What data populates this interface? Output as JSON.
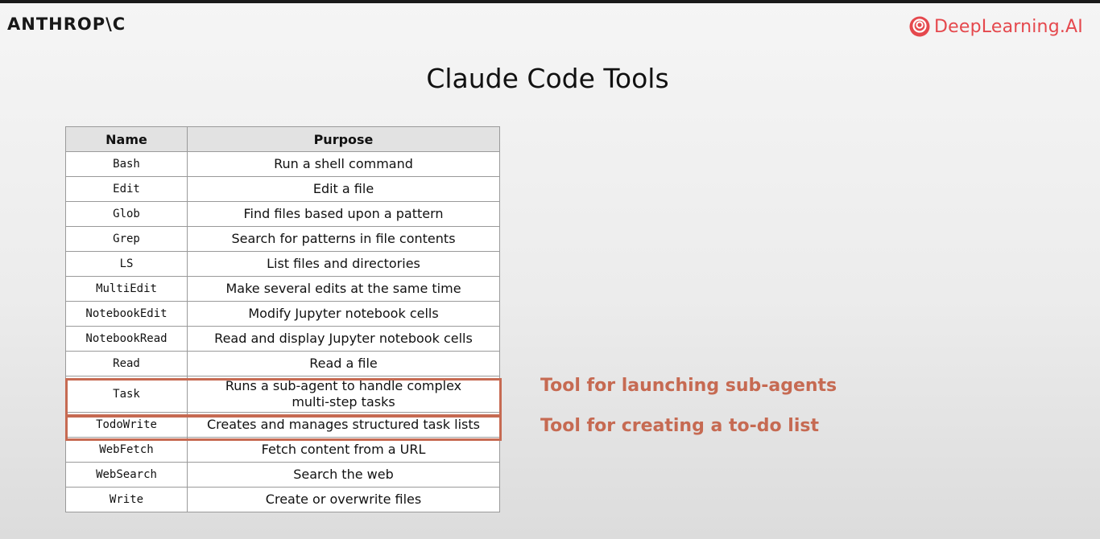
{
  "header": {
    "brand_left": "ANTHROP\\C",
    "brand_right": "DeepLearning.AI",
    "brand_right_icon": "deeplearning-ai-logo-icon",
    "brand_right_color": "#e5484d"
  },
  "slide": {
    "title": "Claude Code Tools"
  },
  "table": {
    "headers": {
      "name": "Name",
      "purpose": "Purpose"
    },
    "rows": [
      {
        "name": "Bash",
        "purpose": "Run a shell command"
      },
      {
        "name": "Edit",
        "purpose": "Edit a file"
      },
      {
        "name": "Glob",
        "purpose": "Find files based upon a pattern"
      },
      {
        "name": "Grep",
        "purpose": "Search for patterns in file contents"
      },
      {
        "name": "LS",
        "purpose": "List files and directories"
      },
      {
        "name": "MultiEdit",
        "purpose": "Make several edits at the same time"
      },
      {
        "name": "NotebookEdit",
        "purpose": "Modify Jupyter notebook cells"
      },
      {
        "name": "NotebookRead",
        "purpose": "Read and display Jupyter notebook cells"
      },
      {
        "name": "Read",
        "purpose": "Read a file"
      },
      {
        "name": "Task",
        "purpose": "Runs a sub-agent to handle complex multi-step tasks"
      },
      {
        "name": "TodoWrite",
        "purpose": "Creates and manages structured task lists"
      },
      {
        "name": "WebFetch",
        "purpose": "Fetch content from a URL"
      },
      {
        "name": "WebSearch",
        "purpose": "Search the web"
      },
      {
        "name": "Write",
        "purpose": "Create or overwrite files"
      }
    ]
  },
  "annotations": {
    "task": "Tool for launching sub-agents",
    "todowrite": "Tool for creating a to-do list",
    "color": "#c66a52"
  }
}
